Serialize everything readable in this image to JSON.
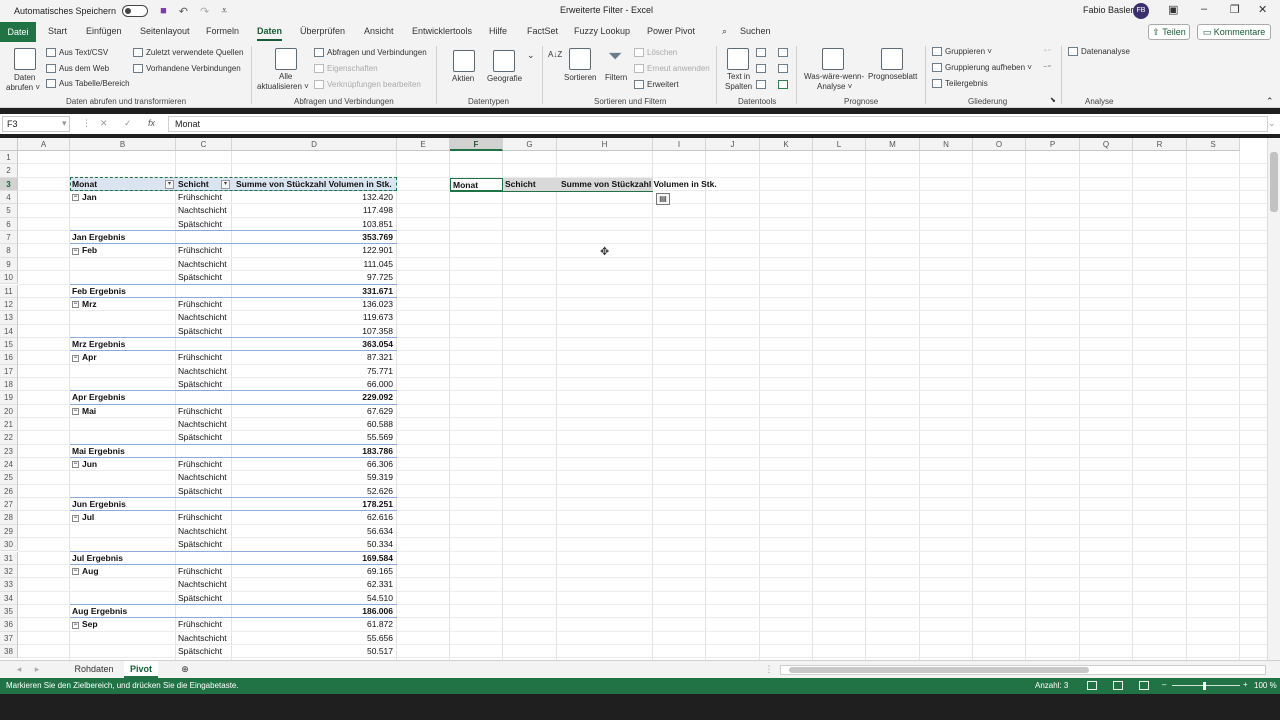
{
  "titlebar": {
    "autosave_label": "Automatisches Speichern",
    "title": "Erweiterte Filter - Excel",
    "user": "Fabio Basler",
    "initials": "FB",
    "search": "Suchen"
  },
  "tabs": [
    "Datei",
    "Start",
    "Einfügen",
    "Seitenlayout",
    "Formeln",
    "Daten",
    "Überprüfen",
    "Ansicht",
    "Entwicklertools",
    "Hilfe",
    "FactSet",
    "Fuzzy Lookup",
    "Power Pivot"
  ],
  "active_tab": "Daten",
  "share_label": "Teilen",
  "comment_label": "Kommentare",
  "ribbon": {
    "get_data": {
      "daten_abrufen_1": "Daten",
      "daten_abrufen_2": "abrufen ˅",
      "aus_text": "Aus Text/CSV",
      "aus_web": "Aus dem Web",
      "aus_tabelle": "Aus Tabelle/Bereich",
      "zuletzt": "Zuletzt verwendete Quellen",
      "vorhandene": "Vorhandene Verbindungen",
      "group": "Daten abrufen und transformieren"
    },
    "queries": {
      "alle_1": "Alle",
      "alle_2": "aktualisieren ˅",
      "abfragen": "Abfragen und Verbindungen",
      "eigenschaften": "Eigenschaften",
      "verknuepfungen": "Verknüpfungen bearbeiten",
      "group": "Abfragen und Verbindungen"
    },
    "datatypes": {
      "aktien": "Aktien",
      "geografie": "Geografie",
      "group": "Datentypen"
    },
    "sort": {
      "sortieren": "Sortieren",
      "filtern": "Filtern",
      "loeschen": "Löschen",
      "erneut": "Erneut anwenden",
      "erweitert": "Erweitert",
      "group": "Sortieren und Filtern"
    },
    "tools": {
      "text_1": "Text in",
      "text_2": "Spalten",
      "group": "Datentools"
    },
    "forecast": {
      "was_1": "Was-wäre-wenn-",
      "was_2": "Analyse ˅",
      "prognose": "Prognoseblatt",
      "group": "Prognose"
    },
    "outline": {
      "gruppieren": "Gruppieren ˅",
      "aufheben": "Gruppierung aufheben ˅",
      "teilergebnis": "Teilergebnis",
      "group": "Gliederung"
    },
    "analysis": {
      "datenanalyse": "Datenanalyse",
      "group": "Analyse"
    }
  },
  "formula": {
    "namebox": "F3",
    "value": "Monat",
    "fx": "fx",
    "cancel": "✕",
    "enter": "✓"
  },
  "columns": [
    "A",
    "B",
    "C",
    "D",
    "E",
    "F",
    "G",
    "H",
    "I",
    "J",
    "K",
    "L",
    "M",
    "N",
    "O",
    "P",
    "Q",
    "R",
    "S"
  ],
  "rows": [
    "1",
    "2",
    "3",
    "4",
    "5",
    "6",
    "7",
    "8",
    "9",
    "10",
    "11",
    "12",
    "13",
    "14",
    "15",
    "16",
    "17",
    "18",
    "19",
    "20",
    "21",
    "22",
    "23",
    "24",
    "25",
    "26",
    "27",
    "28",
    "29",
    "30",
    "31",
    "32",
    "33",
    "34",
    "35",
    "36",
    "37",
    "38"
  ],
  "pivot": {
    "headers": {
      "monat": "Monat",
      "schicht": "Schicht",
      "summe": "Summe von Stückzahl Volumen in Stk."
    },
    "lines": [
      {
        "b": "Jan",
        "c": "Frühschicht",
        "d": "132.420",
        "type": "first"
      },
      {
        "b": "",
        "c": "Nachtschicht",
        "d": "117.498",
        "type": "item"
      },
      {
        "b": "",
        "c": "Spätschicht",
        "d": "103.851",
        "type": "item"
      },
      {
        "b": "Jan Ergebnis",
        "c": "",
        "d": "353.769",
        "type": "total"
      },
      {
        "b": "Feb",
        "c": "Frühschicht",
        "d": "122.901",
        "type": "first"
      },
      {
        "b": "",
        "c": "Nachtschicht",
        "d": "111.045",
        "type": "item"
      },
      {
        "b": "",
        "c": "Spätschicht",
        "d": "97.725",
        "type": "item"
      },
      {
        "b": "Feb Ergebnis",
        "c": "",
        "d": "331.671",
        "type": "total"
      },
      {
        "b": "Mrz",
        "c": "Frühschicht",
        "d": "136.023",
        "type": "first"
      },
      {
        "b": "",
        "c": "Nachtschicht",
        "d": "119.673",
        "type": "item"
      },
      {
        "b": "",
        "c": "Spätschicht",
        "d": "107.358",
        "type": "item"
      },
      {
        "b": "Mrz Ergebnis",
        "c": "",
        "d": "363.054",
        "type": "total"
      },
      {
        "b": "Apr",
        "c": "Frühschicht",
        "d": "87.321",
        "type": "first"
      },
      {
        "b": "",
        "c": "Nachtschicht",
        "d": "75.771",
        "type": "item"
      },
      {
        "b": "",
        "c": "Spätschicht",
        "d": "66.000",
        "type": "item"
      },
      {
        "b": "Apr Ergebnis",
        "c": "",
        "d": "229.092",
        "type": "total"
      },
      {
        "b": "Mai",
        "c": "Frühschicht",
        "d": "67.629",
        "type": "first"
      },
      {
        "b": "",
        "c": "Nachtschicht",
        "d": "60.588",
        "type": "item"
      },
      {
        "b": "",
        "c": "Spätschicht",
        "d": "55.569",
        "type": "item"
      },
      {
        "b": "Mai Ergebnis",
        "c": "",
        "d": "183.786",
        "type": "total"
      },
      {
        "b": "Jun",
        "c": "Frühschicht",
        "d": "66.306",
        "type": "first"
      },
      {
        "b": "",
        "c": "Nachtschicht",
        "d": "59.319",
        "type": "item"
      },
      {
        "b": "",
        "c": "Spätschicht",
        "d": "52.626",
        "type": "item"
      },
      {
        "b": "Jun Ergebnis",
        "c": "",
        "d": "178.251",
        "type": "total"
      },
      {
        "b": "Jul",
        "c": "Frühschicht",
        "d": "62.616",
        "type": "first"
      },
      {
        "b": "",
        "c": "Nachtschicht",
        "d": "56.634",
        "type": "item"
      },
      {
        "b": "",
        "c": "Spätschicht",
        "d": "50.334",
        "type": "item"
      },
      {
        "b": "Jul Ergebnis",
        "c": "",
        "d": "169.584",
        "type": "total"
      },
      {
        "b": "Aug",
        "c": "Frühschicht",
        "d": "69.165",
        "type": "first"
      },
      {
        "b": "",
        "c": "Nachtschicht",
        "d": "62.331",
        "type": "item"
      },
      {
        "b": "",
        "c": "Spätschicht",
        "d": "54.510",
        "type": "item"
      },
      {
        "b": "Aug Ergebnis",
        "c": "",
        "d": "186.006",
        "type": "total"
      },
      {
        "b": "Sep",
        "c": "Frühschicht",
        "d": "61.872",
        "type": "first"
      },
      {
        "b": "",
        "c": "Nachtschicht",
        "d": "55.656",
        "type": "item"
      },
      {
        "b": "",
        "c": "Spätschicht",
        "d": "50.517",
        "type": "item"
      }
    ]
  },
  "copied": {
    "f": "Monat",
    "g": "Schicht",
    "h": "Summe von Stückzahl Volumen in Stk."
  },
  "sheets": [
    "Rohdaten",
    "Pivot"
  ],
  "active_sheet": "Pivot",
  "status": {
    "message": "Markieren Sie den Zielbereich, und drücken Sie die Eingabetaste.",
    "count": "Anzahl: 3",
    "zoom": "100 %"
  },
  "colors": {
    "accent": "#217346",
    "pivot_header": "#dbe5f1"
  }
}
